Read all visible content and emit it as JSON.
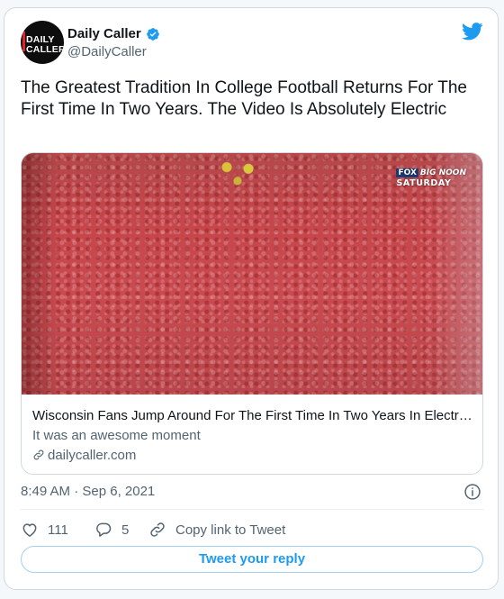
{
  "author": {
    "display_name": "Daily Caller",
    "handle": "@DailyCaller",
    "avatar_line1": "DAILY",
    "avatar_line2": "CALLER"
  },
  "tweet": {
    "text": "The Greatest Tradition In College Football Returns For The First Time In Two Years. The Video Is Absolutely Electric",
    "timestamp": "8:49 AM · Sep 6, 2021"
  },
  "link_card": {
    "overlay_brand_fox": "FOX",
    "overlay_brand_show": "BIG NOON",
    "overlay_brand_day": "SATURDAY",
    "title": "Wisconsin Fans Jump Around For The First Time In Two Years In Electr…",
    "description": "It was an awesome moment",
    "domain": "dailycaller.com"
  },
  "actions": {
    "like_count": "111",
    "reply_count": "5",
    "copy_link_label": "Copy link to Tweet"
  },
  "reply_button_label": "Tweet your reply",
  "icons": {
    "verified": "verified-badge-icon",
    "bird": "twitter-bird-icon",
    "info": "info-icon",
    "heart": "heart-icon",
    "reply": "reply-bubble-icon",
    "link": "link-icon"
  },
  "colors": {
    "accent": "#1d9bf0",
    "text_primary": "#0f1419",
    "text_secondary": "#536471",
    "border": "#cfd9de"
  }
}
